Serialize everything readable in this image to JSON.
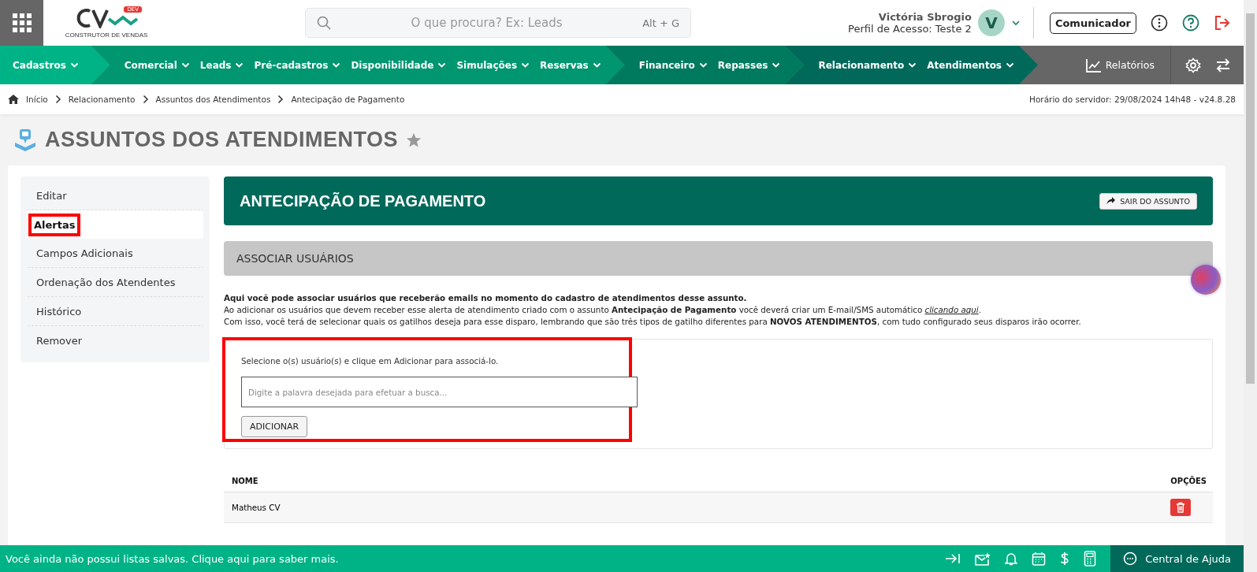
{
  "header": {
    "logo": {
      "badge": "DEV",
      "tagline": "CONSTRUTOR DE VENDAS"
    },
    "search": {
      "placeholder": "O que procura? Ex: Leads",
      "shortcut": "Alt + G"
    },
    "user": {
      "name": "Victória Sbrogio",
      "profile": "Perfil de Acesso: Teste 2",
      "initial": "V"
    },
    "communicator_button": "Comunicador"
  },
  "nav": {
    "groups": [
      {
        "color": "#00b386",
        "items": [
          "Cadastros"
        ]
      },
      {
        "color": "#009670",
        "items": [
          "Comercial",
          "Leads",
          "Pré-cadastros",
          "Disponibilidade",
          "Simulações",
          "Reservas"
        ]
      },
      {
        "color": "#007a5e",
        "items": [
          "Financeiro",
          "Repasses"
        ]
      },
      {
        "color": "#00695a",
        "items": [
          "Relacionamento",
          "Atendimentos"
        ]
      }
    ],
    "reports": "Relatórios"
  },
  "breadcrumb": {
    "items": [
      "Início",
      "Relacionamento",
      "Assuntos dos Atendimentos",
      "Antecipação de Pagamento"
    ],
    "server_time": "Horário do servidor: 29/08/2024 14h48 - v24.8.28"
  },
  "page_title": "ASSUNTOS DOS ATENDIMENTOS",
  "favorite": false,
  "sidebar": {
    "items": [
      {
        "label": "Editar",
        "selected": false,
        "highlighted": false
      },
      {
        "label": "Alertas",
        "selected": true,
        "highlighted": true
      },
      {
        "label": "Campos Adicionais",
        "selected": false,
        "highlighted": false
      },
      {
        "label": "Ordenação dos Atendentes",
        "selected": false,
        "highlighted": false
      },
      {
        "label": "Histórico",
        "selected": false,
        "highlighted": false
      },
      {
        "label": "Remover",
        "selected": false,
        "highlighted": false
      }
    ]
  },
  "subject": {
    "title": "ANTECIPAÇÃO DE PAGAMENTO",
    "exit_button": "SAIR DO ASSUNTO"
  },
  "section": {
    "title": "ASSOCIAR USUÁRIOS",
    "intro": "Aqui você pode associar usuários que receberão emails no momento do cadastro de atendimentos desse assunto.",
    "line_2": "Ao adicionar os usuários que devem receber esse alerta de atendimento criado com o assunto **Antecipação de Pagamento** você deverá criar um E-mail/SMS automático",
    "link": "clicando aqui",
    "line_2_end": ".",
    "line_3": "Com isso, você terá de selecionar quais os gatilhos deseja para esse disparo, lembrando que são três tipos de gatilho diferentes para **NOVOS ATENDIMENTOS**, com tudo configurado seus disparos irão ocorrer."
  },
  "form": {
    "highlighted": true,
    "instruction": "Selecione o(s) usuário(s) e clique em Adicionar para associá-lo.",
    "placeholder": "Digite a palavra desejada para efetuar a busca...",
    "add_button": "ADICIONAR"
  },
  "table": {
    "columns": [
      "NOME",
      "OPÇÕES"
    ],
    "rows": [
      {
        "name": "Matheus CV"
      }
    ]
  },
  "footer": {
    "message": "Você ainda não possui listas salvas. Clique aqui para saber mais.",
    "help": "Central de Ajuda"
  }
}
